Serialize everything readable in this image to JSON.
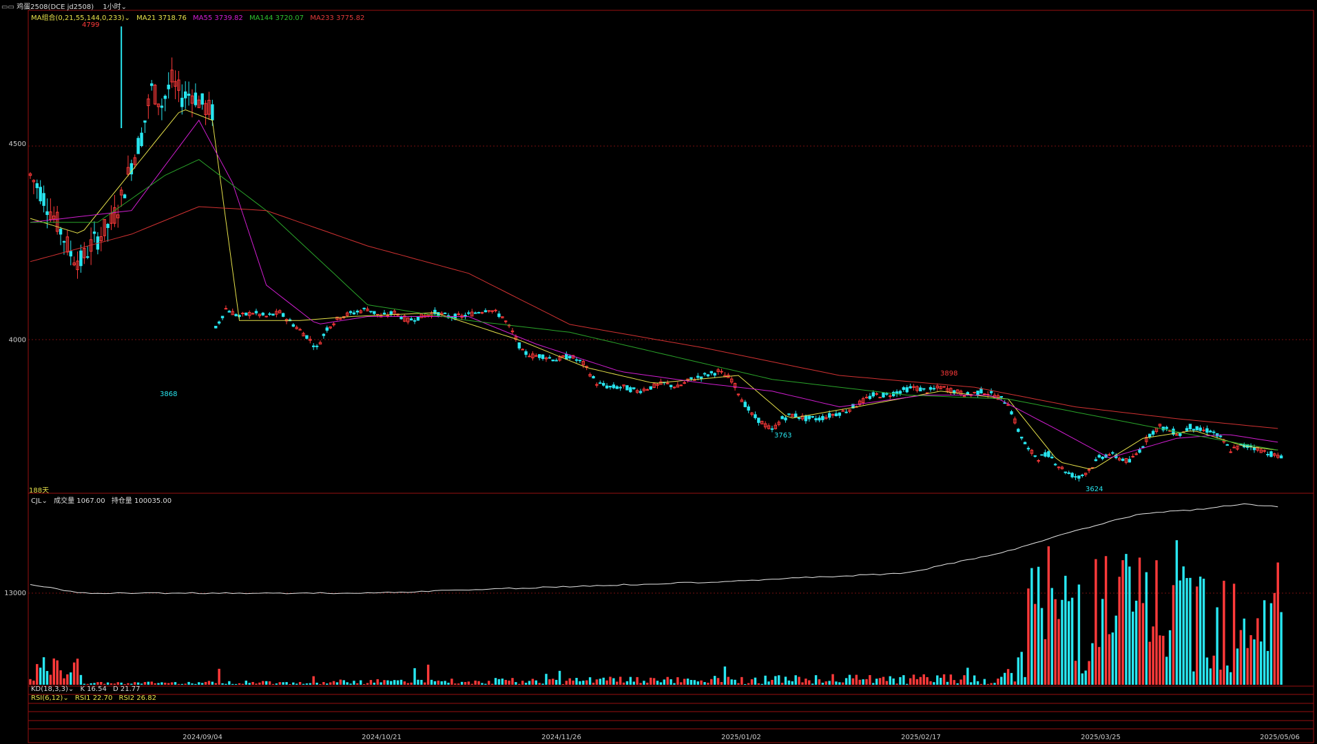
{
  "header": {
    "symbol": "鸡蛋2508(DCE  jd2508)",
    "period": "1小时"
  },
  "colors": {
    "up": "#ff3a3a",
    "down": "#28e6f0",
    "ma21": "#e6e14a",
    "ma55": "#d21ed2",
    "ma144": "#2aa52a",
    "ma233": "#d23232",
    "frame": "#9a1010"
  },
  "main_panel": {
    "ma_group": "MA组合(0,21,55,144,0,233)",
    "ma21": "MA21 3718.76",
    "ma55": "MA55 3739.82",
    "ma144": "MA144 3720.07",
    "ma233": "MA233 3775.82",
    "days_label": "188天",
    "annotations": {
      "high": "4799",
      "low1": "3868",
      "low2": "3763",
      "high2": "3898",
      "low3": "3624"
    }
  },
  "volume_panel": {
    "name": "CJL",
    "volume": "成交量 1067.00",
    "open_interest": "持仓量 100035.00"
  },
  "kd_panel": {
    "name": "KD(18,3,3)",
    "k": "K 16.54",
    "d": "D 21.77"
  },
  "rsi_panel": {
    "name": "RSI(6,12)",
    "rsi1": "RSI1 22.70",
    "rsi2": "RSI2 26.82"
  },
  "chart_data": {
    "type": "candlestick",
    "interval": "1小时",
    "y_ticks": [
      4500,
      4000
    ],
    "ylim": [
      3610,
      4840
    ],
    "volume_ytick": 13000,
    "x_tick_labels": [
      "2024/09/04",
      "2024/10/21",
      "2024/11/26",
      "2025/01/02",
      "2025/02/17",
      "2025/03/25",
      "2025/05/06"
    ],
    "price_path": [
      [
        0,
        4420
      ],
      [
        3,
        4380
      ],
      [
        6,
        4330
      ],
      [
        9,
        4280
      ],
      [
        12,
        4220
      ],
      [
        15,
        4200
      ],
      [
        18,
        4240
      ],
      [
        21,
        4270
      ],
      [
        24,
        4300
      ],
      [
        27,
        4360
      ],
      [
        30,
        4450
      ],
      [
        33,
        4520
      ],
      [
        36,
        4640
      ],
      [
        39,
        4600
      ],
      [
        42,
        4660
      ],
      [
        45,
        4620
      ],
      [
        48,
        4630
      ],
      [
        51,
        4600
      ],
      [
        54,
        4580
      ],
      [
        55,
        4030
      ],
      [
        58,
        4080
      ],
      [
        62,
        4060
      ],
      [
        66,
        4070
      ],
      [
        70,
        4060
      ],
      [
        74,
        4070
      ],
      [
        78,
        4040
      ],
      [
        82,
        4010
      ],
      [
        85,
        3980
      ],
      [
        88,
        4030
      ],
      [
        92,
        4060
      ],
      [
        96,
        4070
      ],
      [
        100,
        4080
      ],
      [
        104,
        4060
      ],
      [
        108,
        4070
      ],
      [
        112,
        4050
      ],
      [
        116,
        4060
      ],
      [
        120,
        4070
      ],
      [
        124,
        4060
      ],
      [
        128,
        4060
      ],
      [
        132,
        4070
      ],
      [
        136,
        4080
      ],
      [
        140,
        4060
      ],
      [
        143,
        4020
      ],
      [
        146,
        3970
      ],
      [
        149,
        3960
      ],
      [
        152,
        3960
      ],
      [
        156,
        3950
      ],
      [
        160,
        3960
      ],
      [
        164,
        3940
      ],
      [
        168,
        3890
      ],
      [
        172,
        3880
      ],
      [
        176,
        3880
      ],
      [
        180,
        3870
      ],
      [
        184,
        3880
      ],
      [
        188,
        3890
      ],
      [
        192,
        3880
      ],
      [
        196,
        3900
      ],
      [
        200,
        3910
      ],
      [
        204,
        3920
      ],
      [
        208,
        3900
      ],
      [
        211,
        3850
      ],
      [
        214,
        3810
      ],
      [
        217,
        3790
      ],
      [
        220,
        3770
      ],
      [
        223,
        3800
      ],
      [
        226,
        3810
      ],
      [
        230,
        3800
      ],
      [
        234,
        3800
      ],
      [
        238,
        3810
      ],
      [
        242,
        3820
      ],
      [
        246,
        3840
      ],
      [
        250,
        3860
      ],
      [
        254,
        3860
      ],
      [
        258,
        3870
      ],
      [
        262,
        3880
      ],
      [
        266,
        3870
      ],
      [
        270,
        3880
      ],
      [
        274,
        3870
      ],
      [
        278,
        3860
      ],
      [
        282,
        3870
      ],
      [
        286,
        3860
      ],
      [
        290,
        3840
      ],
      [
        293,
        3770
      ],
      [
        296,
        3720
      ],
      [
        299,
        3700
      ],
      [
        302,
        3710
      ],
      [
        305,
        3680
      ],
      [
        308,
        3660
      ],
      [
        311,
        3650
      ],
      [
        314,
        3670
      ],
      [
        317,
        3700
      ],
      [
        320,
        3710
      ],
      [
        323,
        3700
      ],
      [
        326,
        3690
      ],
      [
        329,
        3720
      ],
      [
        332,
        3760
      ],
      [
        335,
        3780
      ],
      [
        338,
        3770
      ],
      [
        341,
        3760
      ],
      [
        344,
        3780
      ],
      [
        347,
        3770
      ],
      [
        350,
        3770
      ],
      [
        353,
        3750
      ],
      [
        356,
        3720
      ],
      [
        359,
        3730
      ],
      [
        362,
        3730
      ],
      [
        365,
        3720
      ],
      [
        368,
        3710
      ],
      [
        371,
        3700
      ]
    ],
    "ma_series": [
      {
        "name": "MA21",
        "values": [
          [
            0,
            4310
          ],
          [
            15,
            4270
          ],
          [
            30,
            4430
          ],
          [
            45,
            4590
          ],
          [
            54,
            4560
          ],
          [
            62,
            4050
          ],
          [
            80,
            4050
          ],
          [
            95,
            4060
          ],
          [
            120,
            4070
          ],
          [
            145,
            4000
          ],
          [
            165,
            3930
          ],
          [
            185,
            3890
          ],
          [
            210,
            3910
          ],
          [
            225,
            3800
          ],
          [
            245,
            3830
          ],
          [
            270,
            3870
          ],
          [
            290,
            3850
          ],
          [
            305,
            3690
          ],
          [
            315,
            3670
          ],
          [
            330,
            3750
          ],
          [
            345,
            3770
          ],
          [
            360,
            3730
          ],
          [
            370,
            3720
          ]
        ]
      },
      {
        "name": "MA55",
        "values": [
          [
            0,
            4300
          ],
          [
            30,
            4330
          ],
          [
            50,
            4560
          ],
          [
            60,
            4400
          ],
          [
            70,
            4140
          ],
          [
            85,
            4040
          ],
          [
            100,
            4060
          ],
          [
            130,
            4060
          ],
          [
            150,
            3990
          ],
          [
            175,
            3920
          ],
          [
            200,
            3890
          ],
          [
            220,
            3870
          ],
          [
            240,
            3830
          ],
          [
            265,
            3860
          ],
          [
            285,
            3860
          ],
          [
            305,
            3770
          ],
          [
            320,
            3700
          ],
          [
            340,
            3750
          ],
          [
            355,
            3760
          ],
          [
            370,
            3740
          ]
        ]
      },
      {
        "name": "MA144",
        "values": [
          [
            0,
            4300
          ],
          [
            20,
            4300
          ],
          [
            40,
            4420
          ],
          [
            50,
            4460
          ],
          [
            70,
            4330
          ],
          [
            100,
            4090
          ],
          [
            130,
            4050
          ],
          [
            160,
            4020
          ],
          [
            190,
            3960
          ],
          [
            220,
            3900
          ],
          [
            260,
            3860
          ],
          [
            290,
            3850
          ],
          [
            320,
            3800
          ],
          [
            350,
            3750
          ],
          [
            370,
            3720
          ]
        ]
      },
      {
        "name": "MA233",
        "values": [
          [
            0,
            4200
          ],
          [
            30,
            4270
          ],
          [
            50,
            4340
          ],
          [
            70,
            4330
          ],
          [
            100,
            4240
          ],
          [
            130,
            4170
          ],
          [
            160,
            4040
          ],
          [
            200,
            3980
          ],
          [
            240,
            3910
          ],
          [
            280,
            3880
          ],
          [
            310,
            3830
          ],
          [
            340,
            3800
          ],
          [
            370,
            3775
          ]
        ]
      }
    ]
  }
}
